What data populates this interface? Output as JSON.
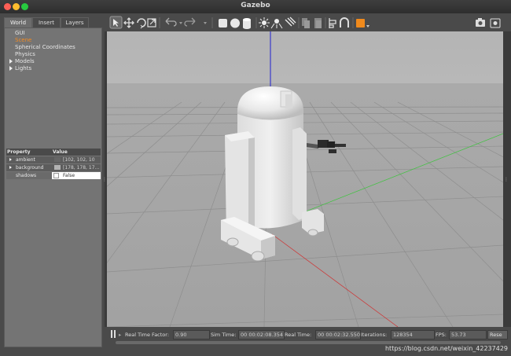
{
  "window": {
    "title": "Gazebo",
    "buttons": {
      "close": "#ff5f56",
      "minimize": "#ffbd2e",
      "maximize": "#27c93f"
    }
  },
  "tabs": [
    "World",
    "Insert",
    "Layers"
  ],
  "world_tree": {
    "items": [
      "GUI",
      "Scene",
      "Spherical Coordinates",
      "Physics",
      "Models",
      "Lights"
    ],
    "selected": "Scene",
    "selected_color": "#f58a1f"
  },
  "properties": {
    "header_property": "Property",
    "header_value": "Value",
    "rows": [
      {
        "name": "ambient",
        "value": "[102, 102, 10"
      },
      {
        "name": "background",
        "value": "[178, 178, 17..."
      },
      {
        "name": "shadows",
        "value": "False"
      }
    ]
  },
  "toolbar": {
    "icons": [
      "select-icon",
      "translate-icon",
      "rotate-icon",
      "scale-icon",
      "undo-icon",
      "redo-icon",
      "box-icon",
      "sphere-icon",
      "cylinder-icon",
      "point-light-icon",
      "spot-light-icon",
      "directional-light-icon",
      "copy-icon",
      "paste-icon",
      "align-icon",
      "snap-icon",
      "color-icon",
      "screenshot-icon",
      "record-icon"
    ]
  },
  "statusbar": {
    "rtf_label": "Real Time Factor:",
    "rtf_value": "0.90",
    "sim_label": "Sim Time:",
    "sim_value": "00 00:02:08.354",
    "real_label": "Real Time:",
    "real_value": "00 00:02:32.550",
    "iter_label": "Iterations:",
    "iter_value": "128354",
    "fps_label": "FPS:",
    "fps_value": "53.73",
    "reset_label": "Rese"
  },
  "watermark": "https://blog.csdn.net/weixin_42237429"
}
